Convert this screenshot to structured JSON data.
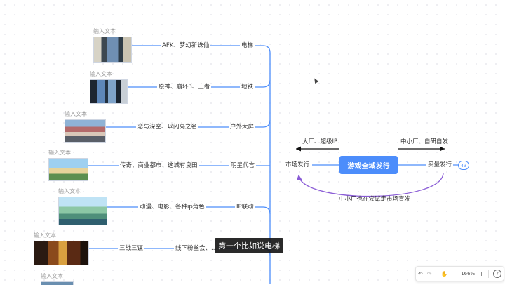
{
  "center": {
    "label": "游戏全域发行",
    "badge": "43"
  },
  "left_hub": "市场发行",
  "right_hub": "买量发行",
  "arrow_left_label": "大厂、超级IP",
  "arrow_right_label": "中小厂、自研自发",
  "curve_label": "中小厂也在尝试走市场宣发",
  "branches": [
    {
      "caption": "输入文本",
      "examples": "AFK、梦幻新诛仙",
      "channel": "电梯"
    },
    {
      "caption": "输入文本",
      "examples": "原神、崩坏3、王者",
      "channel": "地铁"
    },
    {
      "caption": "输入文本",
      "examples": "恋与深空、以闪亮之名",
      "channel": "户外大屏"
    },
    {
      "caption": "输入文本",
      "examples": "传奇、商业都市、这城有良田",
      "channel": "明星代言"
    },
    {
      "caption": "输入文本",
      "examples": "动漫、电影、各种ip角色",
      "channel": "IP联动"
    },
    {
      "caption": "输入文本",
      "examples": "三战三谋",
      "channel": "",
      "extra": "线下粉丝会、..."
    },
    {
      "caption": "输入文本"
    }
  ],
  "subtitle": "第一个比如说电梯",
  "toolbar": {
    "zoom": "166%",
    "minus": "−",
    "plus": "+",
    "help": "?"
  },
  "colors": {
    "accent": "#4c8dfb",
    "curve": "#8a5cd6",
    "line": "#4c8dfb"
  }
}
